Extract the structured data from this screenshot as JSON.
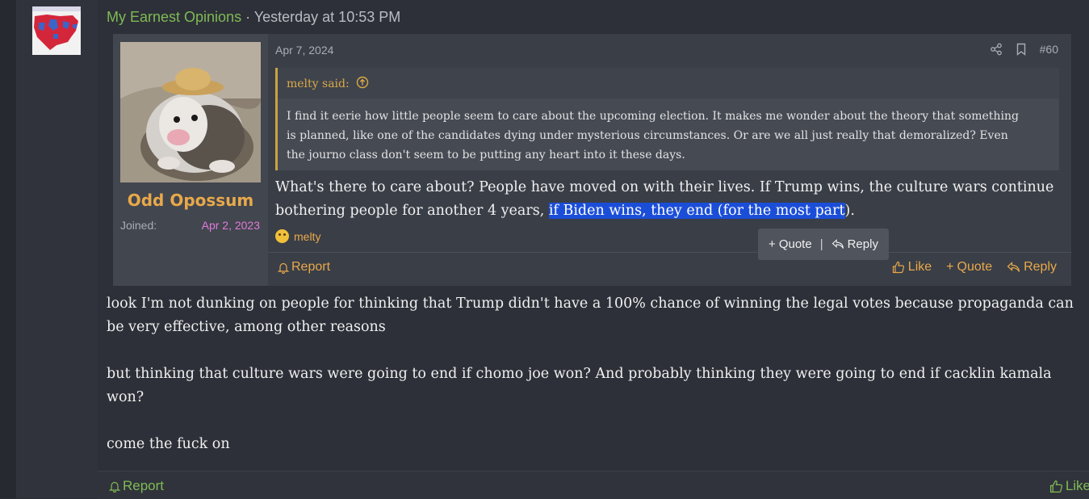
{
  "post": {
    "author": "My Earnest Opinions",
    "separator": "·",
    "timestamp": "Yesterday at 10:53 PM",
    "paragraphs": [
      "look I'm not dunking on people for thinking that Trump didn't have a 100% chance of winning the legal votes because propaganda can be very effective, among other reasons",
      "but thinking that culture wars were going to end if chomo joe won? And probably thinking they were going to end if cacklin kamala won?",
      "come the fuck on"
    ],
    "footer": {
      "report": "Report",
      "like": "Like"
    }
  },
  "embed": {
    "username": "Odd Opossum",
    "joined_label": "Joined:",
    "joined_value": "Apr 2, 2023",
    "date": "Apr 7, 2024",
    "post_number": "#60",
    "quote": {
      "author": "melty said:",
      "text": "I find it eerie how little people seem to care about the upcoming election. It makes me wonder about the theory that something is planned, like one of the candidates dying under mysterious circumstances. Or are we all just really that demoralized? Even the journo class don't seem to be putting any heart into it these days."
    },
    "text_before": "What's there to care about? People have moved on with their lives. If Trump wins, the culture wars continue bothering people for another 4 years, ",
    "text_highlight": "if Biden wins, they end (for the most part",
    "text_after": ").",
    "reaction_user": "melty",
    "selection_popup": {
      "quote": "Quote",
      "reply": "Reply",
      "divider": "|"
    },
    "footer": {
      "report": "Report",
      "like": "Like",
      "quote": "Quote",
      "reply": "Reply"
    }
  },
  "colors": {
    "accent_green": "#7fba55",
    "accent_orange": "#e8a94a",
    "highlight_blue": "#1b4ed8",
    "joined_pink": "#e07bd8"
  },
  "icons": [
    "share-icon",
    "bookmark-icon",
    "arrow-up-circle-icon",
    "thinking-emoji-icon",
    "bell-icon",
    "thumbs-up-icon",
    "plus-icon",
    "reply-icon"
  ]
}
